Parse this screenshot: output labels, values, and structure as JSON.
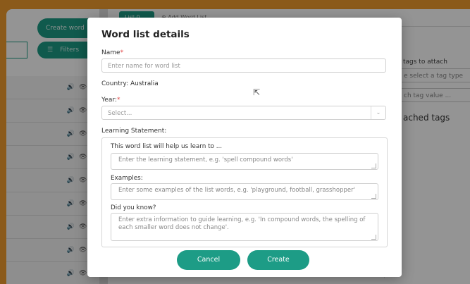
{
  "background": {
    "create_word": "Create word",
    "filters": "Filters",
    "tabs": [
      "List 0",
      "Add Word List"
    ],
    "right_panel": {
      "label": "tags to attach",
      "select_placeholder": "e select a tag type",
      "value_placeholder": "ch tag value ...",
      "title": "ached tags"
    },
    "row_count": 9
  },
  "modal": {
    "title": "Word list details",
    "name_label": "Name",
    "name_placeholder": "Enter name for word list",
    "country_text": "Country: Australia",
    "year_label": "Year:",
    "year_placeholder": "Select...",
    "learning_label": "Learning Statement:",
    "learn_to_label": "This word list will help us learn to ...",
    "learn_to_placeholder": "Enter the learning statement, e.g. 'spell compound words'",
    "examples_label": "Examples:",
    "examples_placeholder": "Enter some examples of the list words, e.g. 'playground, football, grasshopper'",
    "did_you_know_label": "Did you know?",
    "did_you_know_placeholder": "Enter extra information to guide learning, e.g. 'In compound words, the spelling of each smaller word does not change'.",
    "cancel_label": "Cancel",
    "create_label": "Create",
    "required_mark": "*"
  },
  "colors": {
    "accent": "#1d9c86",
    "frame": "#ef9b2d",
    "required": "#e04646"
  }
}
